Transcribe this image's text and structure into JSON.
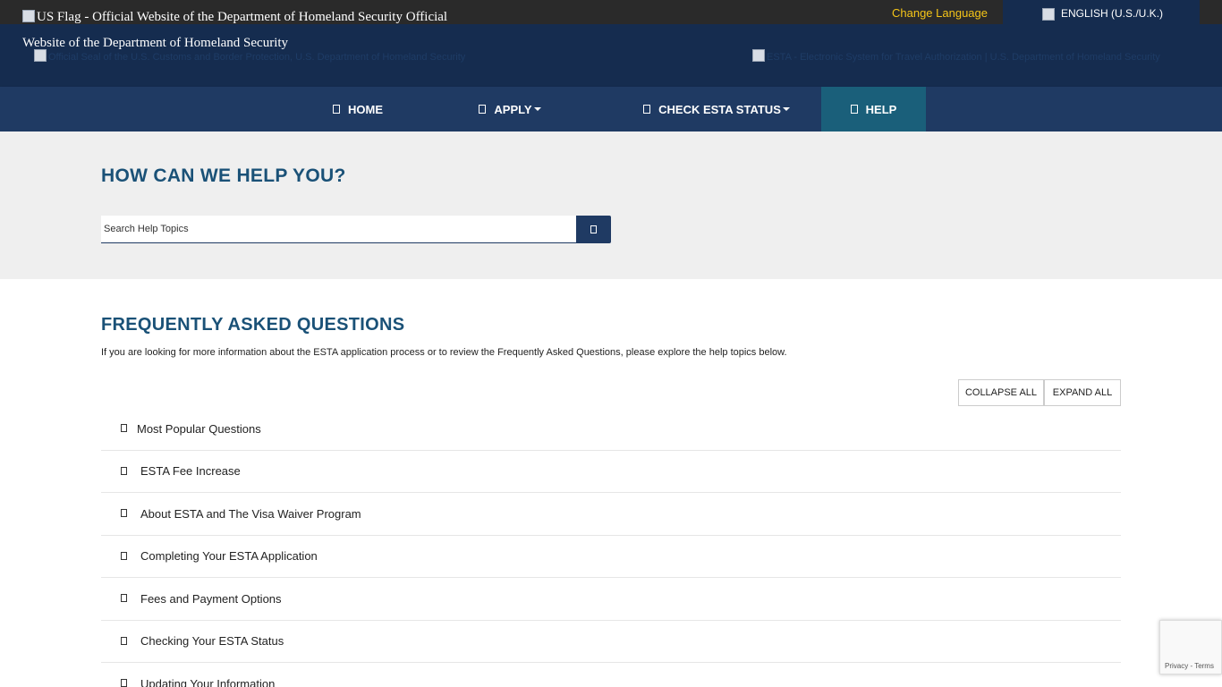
{
  "banner": {
    "flag_alt": "US Flag - Official Website of the Department of Homeland Security",
    "official_label": "Official Website of the Department of Homeland Security",
    "change_language": "Change Language",
    "language_selected": "ENGLISH (U.S./U.K.)",
    "seal_alt": "Official Seal of the U.S. Customs and Border Protection, U.S. Department of Homeland Security",
    "esta_logo_alt": "ESTA - Electronic System for Travel Authorization | U.S. Department of Homeland Security"
  },
  "nav": {
    "items": [
      {
        "label": "HOME",
        "icon": "home-icon",
        "dropdown": false,
        "active": false
      },
      {
        "label": "APPLY",
        "icon": "apply-icon",
        "dropdown": true,
        "active": false
      },
      {
        "label": "CHECK ESTA STATUS",
        "icon": "status-icon",
        "dropdown": true,
        "active": false
      },
      {
        "label": "HELP",
        "icon": "help-icon",
        "dropdown": false,
        "active": true
      }
    ]
  },
  "help": {
    "title": "HOW CAN WE HELP YOU?",
    "search_placeholder": "Search Help Topics",
    "search_icon": "search-icon"
  },
  "faq": {
    "title": "FREQUENTLY ASKED QUESTIONS",
    "intro": "If you are looking for more information about the ESTA application process or to review the Frequently Asked Questions, please explore the help topics below.",
    "collapse_all": "COLLAPSE ALL",
    "expand_all": "EXPAND ALL",
    "topics": [
      "Most Popular Questions",
      "ESTA Fee Increase",
      "About ESTA and The Visa Waiver Program",
      "Completing Your ESTA Application",
      "Fees and Payment Options",
      "Checking Your ESTA Status",
      "Updating Your Information"
    ]
  },
  "recaptcha": {
    "links": "Privacy - Terms"
  },
  "colors": {
    "banner": "#152c4f",
    "nav": "#1f3a63",
    "nav_active": "#1a5f7a",
    "heading": "#1a5177",
    "change_language": "#f5c518"
  }
}
